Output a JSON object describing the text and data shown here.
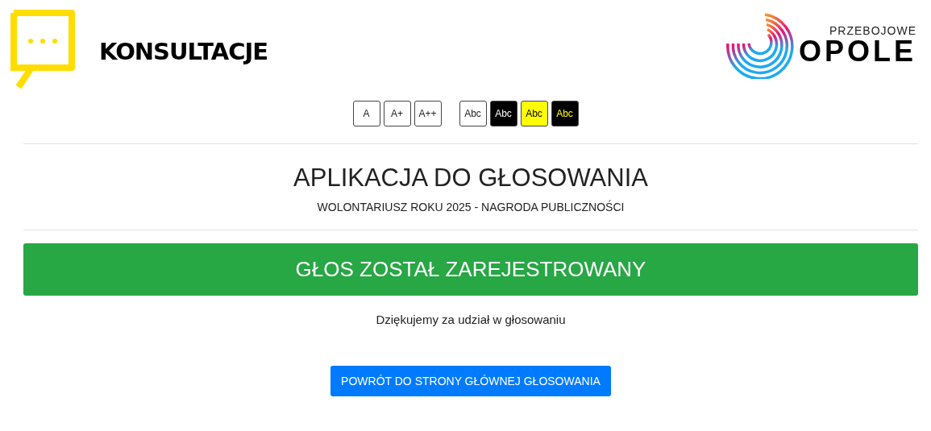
{
  "header": {
    "brand": "KONSULTACJE",
    "partner_small": "PRZEBOJOWE",
    "partner_big": "OPOLE"
  },
  "font_sizes": [
    "A",
    "A+",
    "A++"
  ],
  "contrasts": [
    {
      "label": "Abc",
      "kind": "default"
    },
    {
      "label": "Abc",
      "kind": "white-on-black"
    },
    {
      "label": "Abc",
      "kind": "black-on-yellow"
    },
    {
      "label": "Abc",
      "kind": "yellow-on-black"
    }
  ],
  "title": "APLIKACJA DO GŁOSOWANIA",
  "subtitle": "WOLONTARIUSZ ROKU 2025 - NAGRODA PUBLICZNOŚCI",
  "alert": "GŁOS ZOSTAŁ ZAREJESTROWANY",
  "message": "Dziękujemy za udział w głosowaniu",
  "back_button": "POWRÓT DO STRONY GŁÓWNEJ GŁOSOWANIA"
}
